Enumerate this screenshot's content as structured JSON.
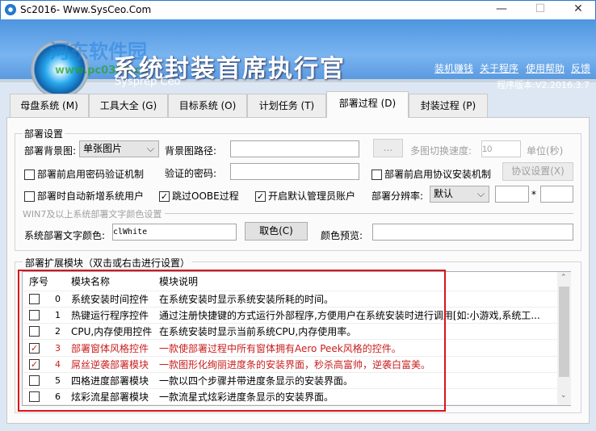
{
  "window": {
    "title": "Sc2016- Www.SysCeo.Com",
    "min": "—",
    "max": "☐",
    "close": "✕"
  },
  "header": {
    "title": "系统封装首席执行官",
    "subtitle": "Sysprep  Ceo",
    "links": [
      "装机赚钱",
      "关于程序",
      "使用帮助",
      "反馈"
    ],
    "version": "程序版本:V2.2016.3.7",
    "watermark": "河东软件园",
    "watermark_url": "www.pc0359.cn"
  },
  "tabs": [
    "母盘系统 (M)",
    "工具大全 (G)",
    "目标系统 (O)",
    "计划任务 (T)",
    "部署过程 (D)",
    "封装过程 (P)"
  ],
  "active_tab": 4,
  "deploy": {
    "group": "部署设置",
    "bg_label": "部署背景图:",
    "bg_value": "单张图片",
    "path_label": "背景图路径:",
    "path_value": "",
    "browse": "...",
    "speed_label": "多图切换速度:",
    "speed_value": "10",
    "unit": "单位(秒)",
    "pwd_check": "部署前启用密码验证机制",
    "pwd_label": "验证的密码:",
    "pwd_value": "",
    "proto_check": "部署前启用协议安装机制",
    "proto_btn": "协议设置(X)",
    "adduser_check": "部署时自动新增系统用户",
    "oobe_check": "跳过OOBE过程",
    "admin_check": "开启默认管理员账户",
    "res_label": "部署分辨率:",
    "res_value": "默认",
    "res_w": "",
    "res_x": "*",
    "res_h": "",
    "color_section": "WIN7及以上系统部署文字颜色设置",
    "color_label": "系统部署文字颜色:",
    "color_value": "clWhite",
    "pick_btn": "取色(C)",
    "preview_label": "颜色预览:"
  },
  "modules": {
    "group": "部署扩展模块（双击或右击进行设置）",
    "headers": [
      "序号",
      "模块名称",
      "模块说明"
    ],
    "rows": [
      {
        "checked": false,
        "id": "0",
        "name": "系统安装时间控件",
        "desc": "在系统安装时显示系统安装所耗的时间。",
        "red": false
      },
      {
        "checked": false,
        "id": "1",
        "name": "热键运行程序控件",
        "desc": "通过注册快捷键的方式运行外部程序,方便用户在系统安装时进行调用[如:小游戏,系统工...",
        "red": false
      },
      {
        "checked": false,
        "id": "2",
        "name": "CPU,内存使用控件",
        "desc": "在系统安装时显示当前系统CPU,内存使用率。",
        "red": false
      },
      {
        "checked": true,
        "id": "3",
        "name": "部署窗体风格控件",
        "desc": "一款使部署过程中所有窗体拥有Aero Peek风格的控件。",
        "red": true
      },
      {
        "checked": true,
        "id": "4",
        "name": "屌丝逆袭部署模块",
        "desc": "一款图形化绚丽进度条的安装界面，秒杀高富帅，逆袭白富美。",
        "red": true
      },
      {
        "checked": false,
        "id": "5",
        "name": "四格进度部署模块",
        "desc": "一款以四个步骤并带进度条显示的安装界面。",
        "red": false
      },
      {
        "checked": false,
        "id": "6",
        "name": "炫彩流星部署模块",
        "desc": "一款流星式炫彩进度条显示的安装界面。",
        "red": false
      }
    ]
  },
  "colors": {
    "highlight": "#d8151b",
    "accent": "#4e95e0"
  }
}
